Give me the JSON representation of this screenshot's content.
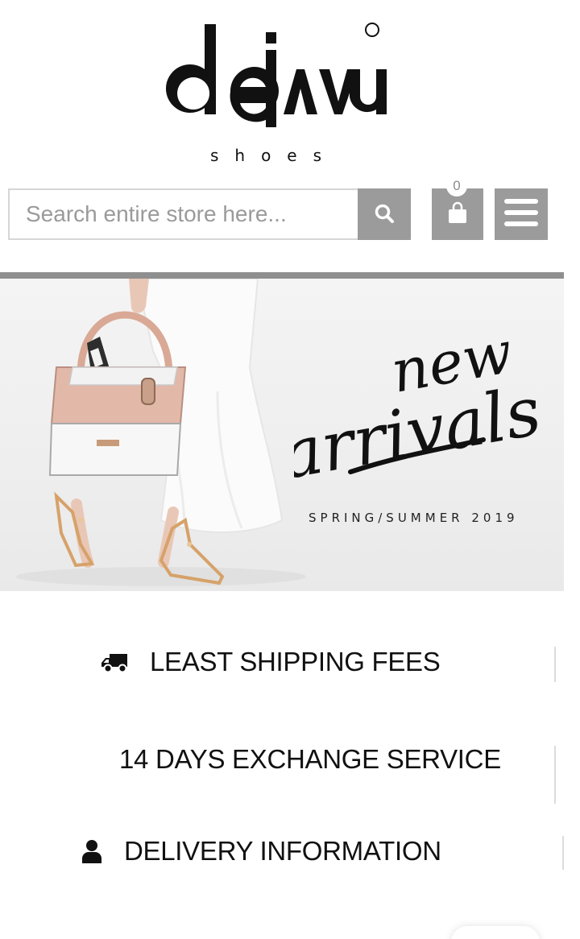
{
  "header": {
    "logo": {
      "brand": "dejavu",
      "tagline": "shoes",
      "registered_mark": "®"
    }
  },
  "search": {
    "placeholder": "Search entire store here..."
  },
  "cart": {
    "count": "0"
  },
  "icons": {
    "search": "search-icon",
    "cart": "shopping-bag-icon",
    "menu": "hamburger-menu-icon",
    "shipping": "truck-icon",
    "delivery": "user-icon"
  },
  "banner": {
    "heading_line1": "new",
    "heading_line2": "arrivals",
    "subtitle": "SPRING/SUMMER 2019"
  },
  "features": [
    {
      "label": "LEAST SHIPPING FEES",
      "icon": "truck-icon"
    },
    {
      "label": "14 DAYS EXCHANGE SERVICE"
    },
    {
      "label": "DELIVERY INFORMATION",
      "icon": "user-icon"
    }
  ],
  "colors": {
    "button_gray": "#9b9b9b",
    "text": "#111111",
    "placeholder": "#9a9a9a"
  }
}
